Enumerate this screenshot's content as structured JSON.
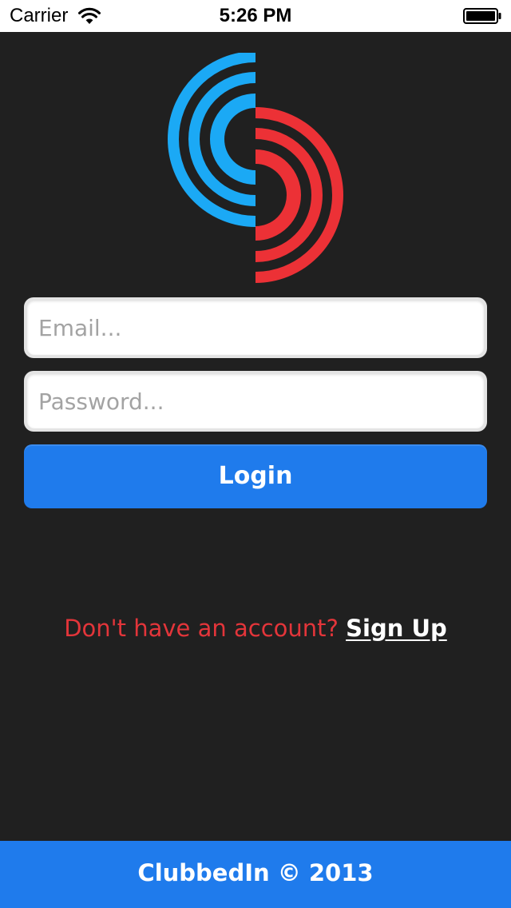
{
  "status_bar": {
    "carrier": "Carrier",
    "time": "5:26 PM",
    "wifi_icon": "wifi-icon",
    "battery_icon": "battery-full-icon"
  },
  "logo": {
    "icon": "clubbedin-logo",
    "colors": {
      "left_half": "#1ba9f5",
      "right_half": "#ec3136"
    }
  },
  "login_form": {
    "email_placeholder": "Email...",
    "email_value": "",
    "password_placeholder": "Password...",
    "password_value": "",
    "login_label": "Login"
  },
  "signup": {
    "prompt": "Don't have an account?",
    "link_label": "Sign Up"
  },
  "footer": {
    "text": "ClubbedIn © 2013"
  },
  "colors": {
    "background": "#202020",
    "accent_blue": "#1f7bec",
    "prompt_red": "#e3353a"
  }
}
